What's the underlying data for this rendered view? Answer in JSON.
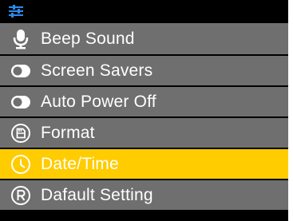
{
  "header": {
    "icon": "settings-sliders-icon",
    "icon_color": "#2a8cf0"
  },
  "menu": {
    "items": [
      {
        "label": "Beep Sound",
        "icon": "microphone-icon"
      },
      {
        "label": "Screen Savers",
        "icon": "toggle-icon"
      },
      {
        "label": "Auto Power Off",
        "icon": "toggle-icon"
      },
      {
        "label": "Format",
        "icon": "sd-card-icon"
      },
      {
        "label": "Date/Time",
        "icon": "clock-icon",
        "selected": true
      },
      {
        "label": "Dafault Setting",
        "icon": "reset-icon"
      }
    ]
  },
  "colors": {
    "item_bg": "#6f6f6f",
    "selected_bg": "#ffcc00",
    "text": "#ffffff",
    "background": "#000000"
  }
}
